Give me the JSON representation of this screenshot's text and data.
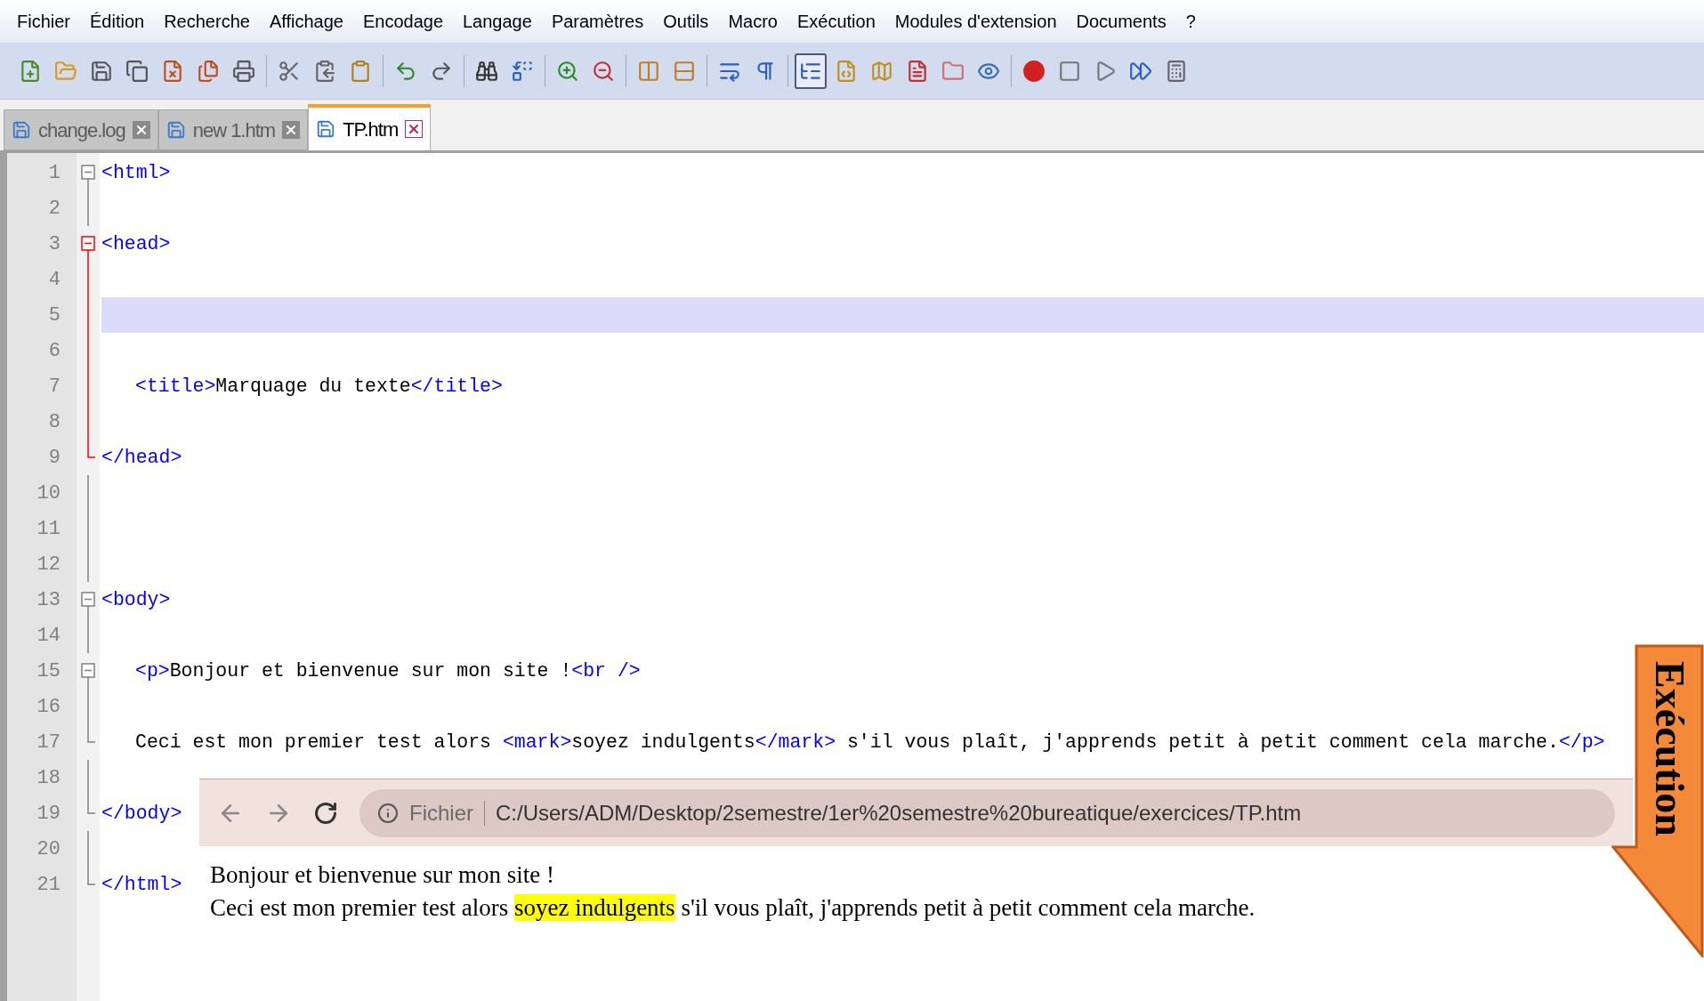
{
  "menu": [
    "Fichier",
    "Édition",
    "Recherche",
    "Affichage",
    "Encodage",
    "Langage",
    "Paramètres",
    "Outils",
    "Macro",
    "Exécution",
    "Modules d'extension",
    "Documents",
    "?"
  ],
  "toolbar": [
    {
      "pressed": false
    },
    {
      "pressed": false
    },
    {
      "pressed": false
    },
    {
      "pressed": false
    },
    {
      "pressed": false
    },
    {
      "pressed": false
    },
    {
      "pressed": false
    },
    {
      "pressed": false
    },
    {
      "pressed": false
    },
    {
      "pressed": false
    },
    {
      "pressed": false
    },
    {
      "pressed": false
    },
    {
      "pressed": false
    },
    {
      "pressed": false
    },
    {
      "pressed": false
    },
    {
      "pressed": false
    },
    {
      "pressed": false
    },
    {
      "pressed": false
    },
    {
      "pressed": false
    },
    {
      "pressed": false
    },
    {
      "pressed": true
    },
    {
      "pressed": false
    },
    {
      "pressed": false
    },
    {
      "pressed": false
    },
    {
      "pressed": false
    },
    {
      "pressed": false
    },
    {
      "pressed": false
    },
    {
      "pressed": false
    },
    {
      "pressed": false
    },
    {
      "pressed": false
    },
    {
      "pressed": false
    }
  ],
  "tabs": [
    {
      "label": "change.log",
      "selected": false
    },
    {
      "label": "new 1.htm",
      "selected": false
    },
    {
      "label": "TP.htm",
      "selected": true
    }
  ],
  "editor": {
    "lines": [
      {
        "number": "1",
        "kind": "open",
        "fold_active": false,
        "current": false,
        "indented": false,
        "segments": [
          {
            "kind": "tag",
            "text": "<html>"
          }
        ]
      },
      {
        "number": "2",
        "kind": "inner",
        "fold_active": false,
        "current": false
      },
      {
        "number": "3",
        "kind": "open",
        "fold_active": true,
        "current": false,
        "indented": false,
        "segments": [
          {
            "kind": "tag",
            "text": "<head>"
          }
        ]
      },
      {
        "number": "4",
        "kind": "inner",
        "fold_active": true,
        "current": false
      },
      {
        "number": "5",
        "kind": "inner",
        "fold_active": true,
        "current": true
      },
      {
        "number": "6",
        "kind": "inner",
        "fold_active": true,
        "current": false
      },
      {
        "number": "7",
        "kind": "inner",
        "fold_active": true,
        "current": false,
        "indented": true,
        "segments": [
          {
            "kind": "tag",
            "text": "<title>"
          },
          {
            "kind": "text",
            "text": "Marquage du texte"
          },
          {
            "kind": "tag",
            "text": "</title>"
          }
        ]
      },
      {
        "number": "8",
        "kind": "inner",
        "fold_active": true,
        "current": false
      },
      {
        "number": "9",
        "kind": "end",
        "fold_active": true,
        "current": false,
        "indented": false,
        "segments": [
          {
            "kind": "tag",
            "text": "</head>"
          }
        ]
      },
      {
        "number": "10",
        "kind": "inner",
        "fold_active": false,
        "current": false
      },
      {
        "number": "11",
        "kind": "inner",
        "fold_active": false,
        "current": false
      },
      {
        "number": "12",
        "kind": "inner",
        "fold_active": false,
        "current": false
      },
      {
        "number": "13",
        "kind": "open",
        "fold_active": false,
        "current": false,
        "indented": false,
        "segments": [
          {
            "kind": "tag",
            "text": "<body>"
          }
        ]
      },
      {
        "number": "14",
        "kind": "inner",
        "fold_active": false,
        "current": false
      },
      {
        "number": "15",
        "kind": "open",
        "fold_active": false,
        "current": false,
        "indented": true,
        "segments": [
          {
            "kind": "tag",
            "text": "<p>"
          },
          {
            "kind": "text",
            "text": "Bonjour et bienvenue sur mon site !"
          },
          {
            "kind": "tag",
            "text": "<br />"
          }
        ]
      },
      {
        "number": "16",
        "kind": "inner",
        "fold_active": false,
        "current": false
      },
      {
        "number": "17",
        "kind": "end",
        "fold_active": false,
        "current": false,
        "indented": true,
        "segments": [
          {
            "kind": "text",
            "text": "Ceci est mon premier test alors "
          },
          {
            "kind": "tag",
            "text": "<mark>"
          },
          {
            "kind": "text",
            "text": "soyez indulgents"
          },
          {
            "kind": "tag",
            "text": "</mark>"
          },
          {
            "kind": "text",
            "text": " s'il vous plaît, j'apprends petit à petit comment cela marche."
          },
          {
            "kind": "tag",
            "text": "</p>"
          }
        ]
      },
      {
        "number": "18",
        "kind": "inner",
        "fold_active": false,
        "current": false
      },
      {
        "number": "19",
        "kind": "end",
        "fold_active": false,
        "current": false,
        "indented": false,
        "segments": [
          {
            "kind": "tag",
            "text": "</body>"
          }
        ]
      },
      {
        "number": "20",
        "kind": "inner",
        "fold_active": false,
        "current": false
      },
      {
        "number": "21",
        "kind": "end",
        "fold_active": false,
        "current": false,
        "indented": false,
        "segments": [
          {
            "kind": "tag",
            "text": "</html>"
          }
        ]
      }
    ]
  },
  "browser": {
    "scheme": "Fichier",
    "url": "C:/Users/ADM/Desktop/2semestre/1er%20semestre%20bureatique/exercices/TP.htm",
    "paragraphs": [
      [
        {
          "text": "Bonjour et bienvenue sur mon site !",
          "highlighted": false
        }
      ],
      [
        {
          "text": "Ceci est mon premier test alors ",
          "highlighted": false
        },
        {
          "text": "soyez indulgents",
          "highlighted": true
        },
        {
          "text": " s'il vous plaît, j'apprends petit à petit comment cela marche.",
          "highlighted": false
        }
      ]
    ]
  },
  "callout": {
    "label": "Exécution"
  }
}
